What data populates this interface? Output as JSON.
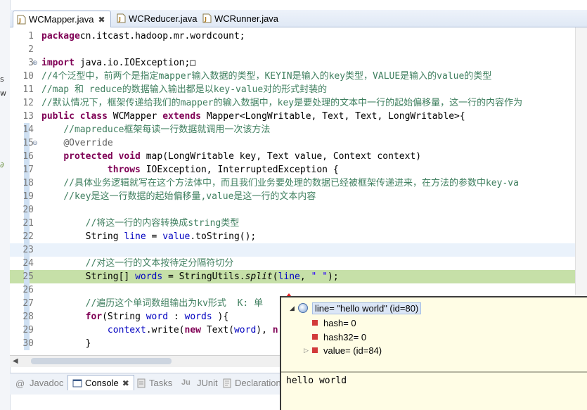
{
  "left_panel": {
    "fragments": [
      "s",
      "w",
      "∂"
    ]
  },
  "tabs": [
    {
      "label": "WCMapper.java",
      "active": true,
      "dirty": true
    },
    {
      "label": "WCReducer.java",
      "active": false
    },
    {
      "label": "WCRunner.java",
      "active": false
    }
  ],
  "editor": {
    "lines": [
      {
        "n": "1",
        "segs": [
          [
            "kw",
            "package"
          ],
          [
            "",
            "cn.itcast.hadoop.mr.wordcount;"
          ]
        ]
      },
      {
        "n": "2",
        "segs": []
      },
      {
        "n": "3",
        "segs": [
          [
            "kw",
            "import"
          ],
          [
            "",
            " java.io.IOException;□"
          ]
        ],
        "fold": "⊕"
      },
      {
        "n": "10",
        "segs": [
          [
            "cm",
            "//4个泛型中，前两个是指定mapper输入数据的类型，KEYIN是输入的key类型，VALUE是输入的value的类型"
          ]
        ]
      },
      {
        "n": "11",
        "segs": [
          [
            "cm",
            "//map 和 reduce的数据输入输出都是以key-value对的形式封装的"
          ]
        ]
      },
      {
        "n": "12",
        "segs": [
          [
            "cm",
            "//默认情况下，框架传递给我们的mapper的输入数据中，key是要处理的文本中一行的起始偏移量，这一行的内容作为"
          ]
        ]
      },
      {
        "n": "13",
        "segs": [
          [
            "kw",
            "public class"
          ],
          [
            "",
            " WCMapper "
          ],
          [
            "kw",
            "extends"
          ],
          [
            "",
            " Mapper<LongWritable, Text, Text, LongWritable>{"
          ]
        ]
      },
      {
        "n": "14",
        "segs": [
          [
            "",
            "    "
          ],
          [
            "cm",
            "//mapreduce框架每读一行数据就调用一次该方法"
          ]
        ],
        "marker": true
      },
      {
        "n": "15",
        "segs": [
          [
            "",
            "    "
          ],
          [
            "an",
            "@Override"
          ]
        ],
        "marker": true,
        "fold": "⊖"
      },
      {
        "n": "16",
        "segs": [
          [
            "",
            "    "
          ],
          [
            "kw",
            "protected void"
          ],
          [
            "",
            " map(LongWritable key, Text value, Context context)"
          ]
        ],
        "marker": true
      },
      {
        "n": "17",
        "segs": [
          [
            "",
            "            "
          ],
          [
            "kw",
            "throws"
          ],
          [
            "",
            " IOException, InterruptedException {"
          ]
        ],
        "marker": true
      },
      {
        "n": "18",
        "segs": [
          [
            "",
            "    "
          ],
          [
            "cm",
            "//具体业务逻辑就写在这个方法体中，而且我们业务要处理的数据已经被框架传递进来，在方法的参数中key-va"
          ]
        ],
        "marker": true
      },
      {
        "n": "19",
        "segs": [
          [
            "",
            "    "
          ],
          [
            "cm",
            "//key是这一行数据的起始偏移量,value是这一行的文本内容"
          ]
        ],
        "marker": true
      },
      {
        "n": "20",
        "segs": [],
        "marker": true
      },
      {
        "n": "21",
        "segs": [
          [
            "",
            "        "
          ],
          [
            "cm",
            "//将这一行的内容转换成string类型"
          ]
        ],
        "marker": true
      },
      {
        "n": "22",
        "segs": [
          [
            "",
            "        String "
          ],
          [
            "fd",
            "line"
          ],
          [
            "",
            " = "
          ],
          [
            "fd",
            "value"
          ],
          [
            "",
            ".toString();"
          ]
        ],
        "marker": true
      },
      {
        "n": "23",
        "segs": [],
        "marker": true,
        "bg": "hl"
      },
      {
        "n": "24",
        "segs": [
          [
            "",
            "        "
          ],
          [
            "cm",
            "//对这一行的文本按待定分隔符切分"
          ]
        ],
        "marker": true
      },
      {
        "n": "25",
        "segs": [
          [
            "",
            "        String[] "
          ],
          [
            "fd",
            "words"
          ],
          [
            "",
            " = StringUtils."
          ],
          [
            "it",
            "split"
          ],
          [
            "",
            "("
          ],
          [
            "fd",
            "line"
          ],
          [
            "",
            ", "
          ],
          [
            "st",
            "\" \""
          ],
          [
            "",
            ");"
          ]
        ],
        "marker": true,
        "bg": "dbg"
      },
      {
        "n": "26",
        "segs": [],
        "marker": true
      },
      {
        "n": "27",
        "segs": [
          [
            "",
            "        "
          ],
          [
            "cm",
            "//遍历这个单词数组输出为kv形式  K: 单"
          ]
        ],
        "marker": true
      },
      {
        "n": "28",
        "segs": [
          [
            "",
            "        "
          ],
          [
            "kw",
            "for"
          ],
          [
            "",
            "(String "
          ],
          [
            "fd",
            "word"
          ],
          [
            "",
            " : "
          ],
          [
            "fd",
            "words"
          ],
          [
            "",
            " ){"
          ]
        ],
        "marker": true
      },
      {
        "n": "29",
        "segs": [
          [
            "",
            "            "
          ],
          [
            "fd",
            "context"
          ],
          [
            "",
            ".write("
          ],
          [
            "kw",
            "new"
          ],
          [
            "",
            " Text("
          ],
          [
            "fd",
            "word"
          ],
          [
            "",
            "), "
          ],
          [
            "kw",
            "n"
          ]
        ],
        "marker": true
      },
      {
        "n": "30",
        "segs": [
          [
            "",
            "        }"
          ]
        ],
        "marker": true
      }
    ]
  },
  "bottom_tabs": [
    {
      "label": "Javadoc",
      "active": false
    },
    {
      "label": "Console",
      "active": true
    },
    {
      "label": "Tasks",
      "active": false
    },
    {
      "label": "JUnit",
      "active": false
    },
    {
      "label": "Declaration",
      "active": false
    }
  ],
  "popup": {
    "root": "line= \"hello world\" (id=80)",
    "children": [
      {
        "label": "hash= 0",
        "expandable": false
      },
      {
        "label": "hash32= 0",
        "expandable": false
      },
      {
        "label": "value= (id=84)",
        "expandable": true
      }
    ],
    "detail": "hello world"
  },
  "colors": {
    "keyword": "#7f0055",
    "comment": "#3f7f5f",
    "debug_line": "#c6e0a8",
    "popup_bg": "#fffde5"
  }
}
